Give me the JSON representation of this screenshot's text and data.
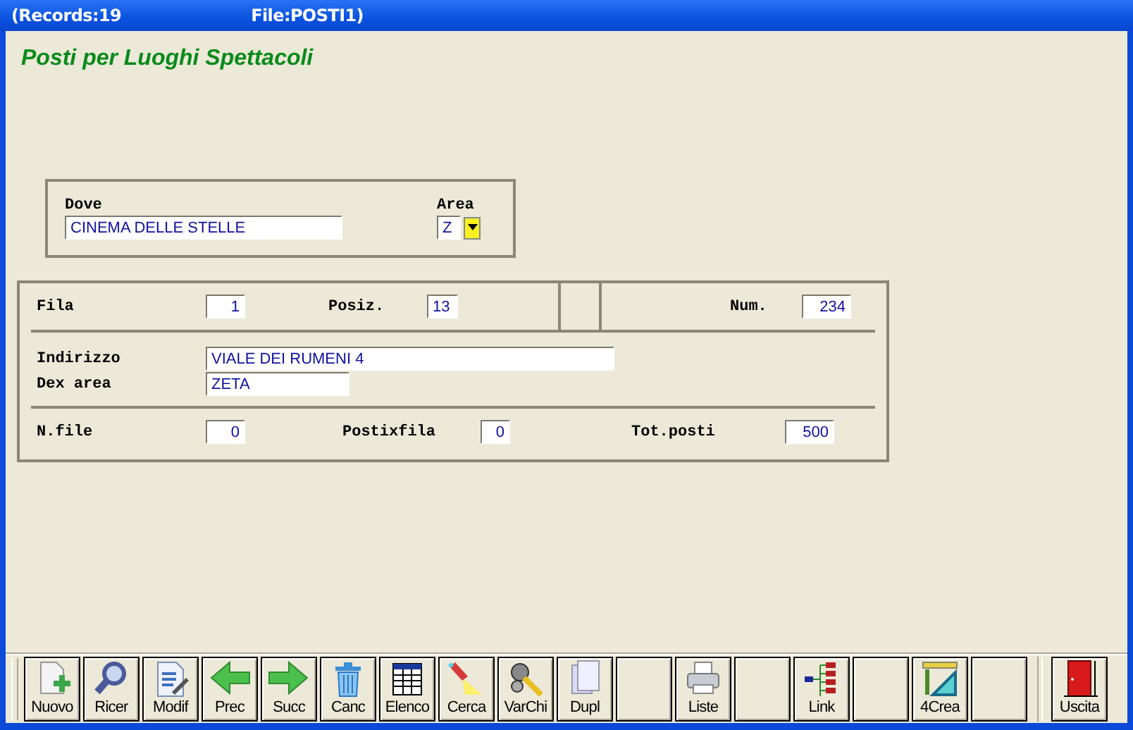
{
  "window": {
    "title_records": "(Records:19",
    "title_file": "File:POSTI1)"
  },
  "heading": "Posti per Luoghi Spettacoli",
  "location_group": {
    "dove": {
      "label": "Dove",
      "value": "CINEMA DELLE STELLE"
    },
    "area": {
      "label": "Area",
      "value": "Z"
    }
  },
  "seat_group": {
    "fila": {
      "label": "Fila",
      "value": "1"
    },
    "posiz": {
      "label": "Posiz.",
      "value": "13"
    },
    "num": {
      "label": "Num.",
      "value": "234"
    },
    "indirizzo": {
      "label": "Indirizzo",
      "value": "VIALE DEI RUMENI 4"
    },
    "dex_area": {
      "label": "Dex area",
      "value": "ZETA"
    },
    "n_file": {
      "label": "N.file",
      "value": "0"
    },
    "postixfila": {
      "label": "Postixfila",
      "value": "0"
    },
    "tot_posti": {
      "label": "Tot.posti",
      "value": "500"
    }
  },
  "toolbar": [
    {
      "kind": "button",
      "label": "Nuovo"
    },
    {
      "kind": "button",
      "label": "Ricer"
    },
    {
      "kind": "button",
      "label": "Modif"
    },
    {
      "kind": "button",
      "label": "Prec"
    },
    {
      "kind": "button",
      "label": "Succ"
    },
    {
      "kind": "button",
      "label": "Canc"
    },
    {
      "kind": "button",
      "label": "Elenco"
    },
    {
      "kind": "button",
      "label": "Cerca"
    },
    {
      "kind": "button",
      "label": "VarChi"
    },
    {
      "kind": "button",
      "label": "Dupl"
    },
    {
      "kind": "blank"
    },
    {
      "kind": "button",
      "label": "Liste"
    },
    {
      "kind": "blank"
    },
    {
      "kind": "button",
      "label": "Link"
    },
    {
      "kind": "blank"
    },
    {
      "kind": "button",
      "label": "4Crea"
    },
    {
      "kind": "blank"
    },
    {
      "kind": "exit",
      "label": "Uscita"
    }
  ]
}
